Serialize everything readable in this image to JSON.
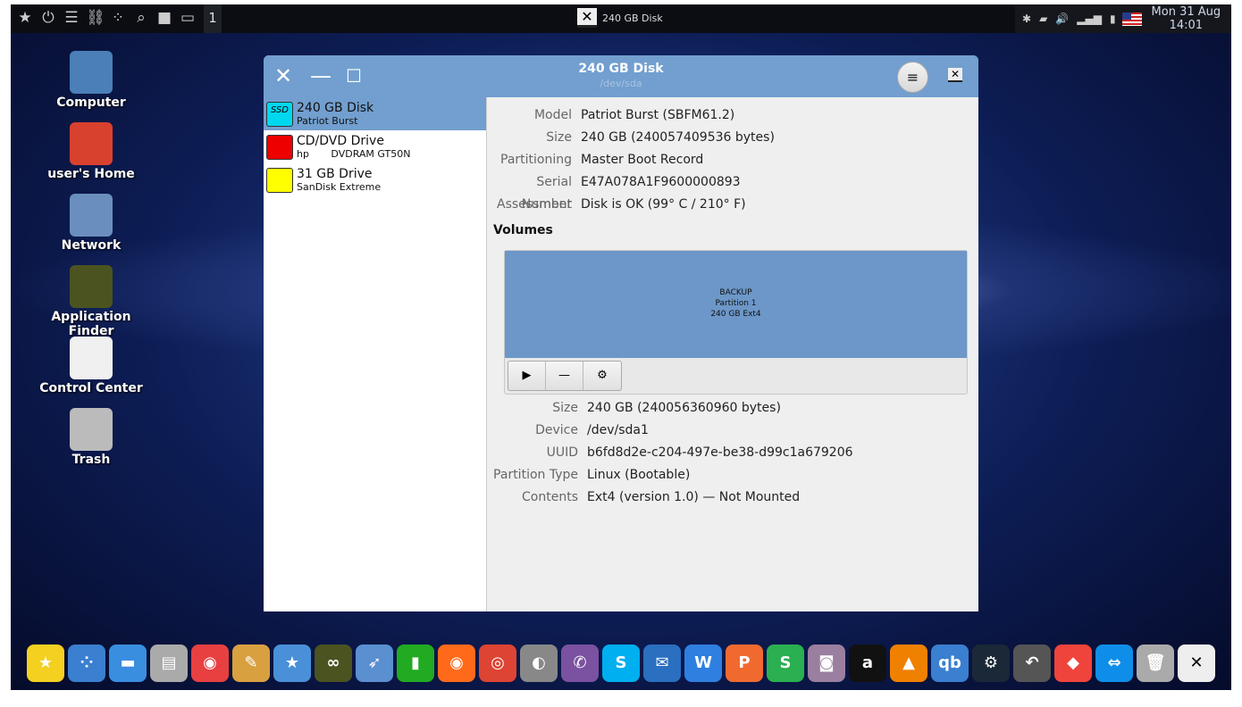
{
  "topbar": {
    "launchers": [
      {
        "icon": "star-icon",
        "glyph": "★"
      },
      {
        "icon": "power-icon",
        "glyph": "⏻"
      },
      {
        "icon": "toggle-icon",
        "glyph": "☰"
      },
      {
        "icon": "binoculars-icon",
        "glyph": "⛓"
      },
      {
        "icon": "apps-grid-icon",
        "glyph": "⁘"
      },
      {
        "icon": "search-icon",
        "glyph": "⌕"
      },
      {
        "icon": "folder-icon",
        "glyph": "■"
      },
      {
        "icon": "desktop-icon",
        "glyph": "▭"
      }
    ],
    "workspace": "1",
    "task_title": "240 GB Disk",
    "tray": [
      {
        "icon": "bluetooth-icon",
        "glyph": "✱"
      },
      {
        "icon": "battery-icon",
        "glyph": "▰"
      },
      {
        "icon": "volume-icon",
        "glyph": "🔊"
      },
      {
        "icon": "signal-icon",
        "glyph": "▂▄▆"
      },
      {
        "icon": "clipboard-icon",
        "glyph": "▮"
      }
    ],
    "flag_icon": "us-flag-icon",
    "clock_date": "Mon 31 Aug",
    "clock_time": "14:01"
  },
  "desktop": [
    {
      "label": "Computer",
      "icon": "computer-icon",
      "color": "#4a7fb8"
    },
    {
      "label": "user's Home",
      "icon": "home-icon",
      "color": "#d9412f"
    },
    {
      "label": "Network",
      "icon": "network-icon",
      "color": "#6a8fbf"
    },
    {
      "label": "Application Finder",
      "icon": "binoculars-icon",
      "color": "#4b5320"
    },
    {
      "label": "Control Center",
      "icon": "control-center-icon",
      "color": "#f0f0f0"
    },
    {
      "label": "Trash",
      "icon": "trash-icon",
      "color": "#bbbbbb"
    }
  ],
  "window": {
    "title": "240 GB Disk",
    "subtitle": "/dev/sda",
    "menu_glyph": "≡",
    "drives": [
      {
        "name": "240 GB Disk",
        "sub": "Patriot Burst",
        "badge": "SSD",
        "color": "#00d8f0",
        "selected": true
      },
      {
        "name": "CD/DVD Drive",
        "sub": "hp       DVDRAM GT50N",
        "badge": "",
        "color": "#ee0000"
      },
      {
        "name": "31 GB Drive",
        "sub": "SanDisk Extreme",
        "badge": "",
        "color": "#ffff00"
      }
    ],
    "disk_info": [
      {
        "k": "Model",
        "v": "Patriot Burst (SBFM61.2)"
      },
      {
        "k": "Size",
        "v": "240 GB (240057409536 bytes)"
      },
      {
        "k": "Partitioning",
        "v": "Master Boot Record"
      },
      {
        "k": "Serial Number",
        "v": "E47A078A1F9600000893"
      },
      {
        "k": "Assessment",
        "v": "Disk is OK (99° C / 210° F)"
      }
    ],
    "volumes_heading": "Volumes",
    "partition": {
      "name": "BACKUP",
      "number": "Partition 1",
      "desc": "240 GB Ext4"
    },
    "volume_tools": [
      {
        "icon": "play-icon",
        "glyph": "▶"
      },
      {
        "icon": "minus-icon",
        "glyph": "—"
      },
      {
        "icon": "gear-icon",
        "glyph": "⚙"
      }
    ],
    "volume_info": [
      {
        "k": "Size",
        "v": "240 GB (240056360960 bytes)"
      },
      {
        "k": "Device",
        "v": "/dev/sda1"
      },
      {
        "k": "UUID",
        "v": "b6fd8d2e-c204-497e-be38-d99c1a679206"
      },
      {
        "k": "Partition Type",
        "v": "Linux (Bootable)"
      },
      {
        "k": "Contents",
        "v": "Ext4 (version 1.0) — Not Mounted"
      }
    ]
  },
  "dock": [
    {
      "icon": "star-icon",
      "glyph": "★",
      "color": "#f4d020"
    },
    {
      "icon": "apps-icon",
      "glyph": "⁘",
      "color": "#3a7fd0"
    },
    {
      "icon": "desktop-icon",
      "glyph": "▬",
      "color": "#3a8ee0"
    },
    {
      "icon": "file-cabinet-icon",
      "glyph": "▤",
      "color": "#aaaaaa"
    },
    {
      "icon": "control-center-icon",
      "glyph": "◉",
      "color": "#e84040"
    },
    {
      "icon": "palette-icon",
      "glyph": "✎",
      "color": "#d9a040"
    },
    {
      "icon": "software-store-icon",
      "glyph": "★",
      "color": "#4a90d9"
    },
    {
      "icon": "binoculars-icon",
      "glyph": "∞",
      "color": "#4b5320"
    },
    {
      "icon": "rocket-icon",
      "glyph": "➶",
      "color": "#5a8fd0"
    },
    {
      "icon": "pipe-icon",
      "glyph": "▮",
      "color": "#22aa22"
    },
    {
      "icon": "firefox-icon",
      "glyph": "◉",
      "color": "#ff6a1a"
    },
    {
      "icon": "chrome-icon",
      "glyph": "◎",
      "color": "#dd4433"
    },
    {
      "icon": "earth-pro-icon",
      "glyph": "◐",
      "color": "#888888"
    },
    {
      "icon": "viber-icon",
      "glyph": "✆",
      "color": "#7b51a1"
    },
    {
      "icon": "skype-icon",
      "glyph": "S",
      "color": "#00aff0"
    },
    {
      "icon": "thunderbird-icon",
      "glyph": "✉",
      "color": "#2a6fc0"
    },
    {
      "icon": "writer-icon",
      "glyph": "W",
      "color": "#2f7fe0"
    },
    {
      "icon": "presentation-icon",
      "glyph": "P",
      "color": "#f06a30"
    },
    {
      "icon": "spreadsheet-icon",
      "glyph": "S",
      "color": "#2ab050"
    },
    {
      "icon": "webcam-icon",
      "glyph": "◙",
      "color": "#9a7fa0"
    },
    {
      "icon": "anydesk-a-icon",
      "glyph": "a",
      "color": "#111111"
    },
    {
      "icon": "vlc-icon",
      "glyph": "▲",
      "color": "#f08000"
    },
    {
      "icon": "qbittorrent-icon",
      "glyph": "qb",
      "color": "#3a7fd0"
    },
    {
      "icon": "steam-icon",
      "glyph": "⚙",
      "color": "#1b2838"
    },
    {
      "icon": "backup-icon",
      "glyph": "↶",
      "color": "#555555"
    },
    {
      "icon": "anydesk-icon",
      "glyph": "◆",
      "color": "#ef443b"
    },
    {
      "icon": "teamviewer-icon",
      "glyph": "⇔",
      "color": "#0e8ee9"
    },
    {
      "icon": "trash-icon",
      "glyph": "🗑",
      "color": "#aaaaaa"
    },
    {
      "icon": "disks-app-icon",
      "glyph": "✕",
      "color": "#eeeeee"
    }
  ]
}
